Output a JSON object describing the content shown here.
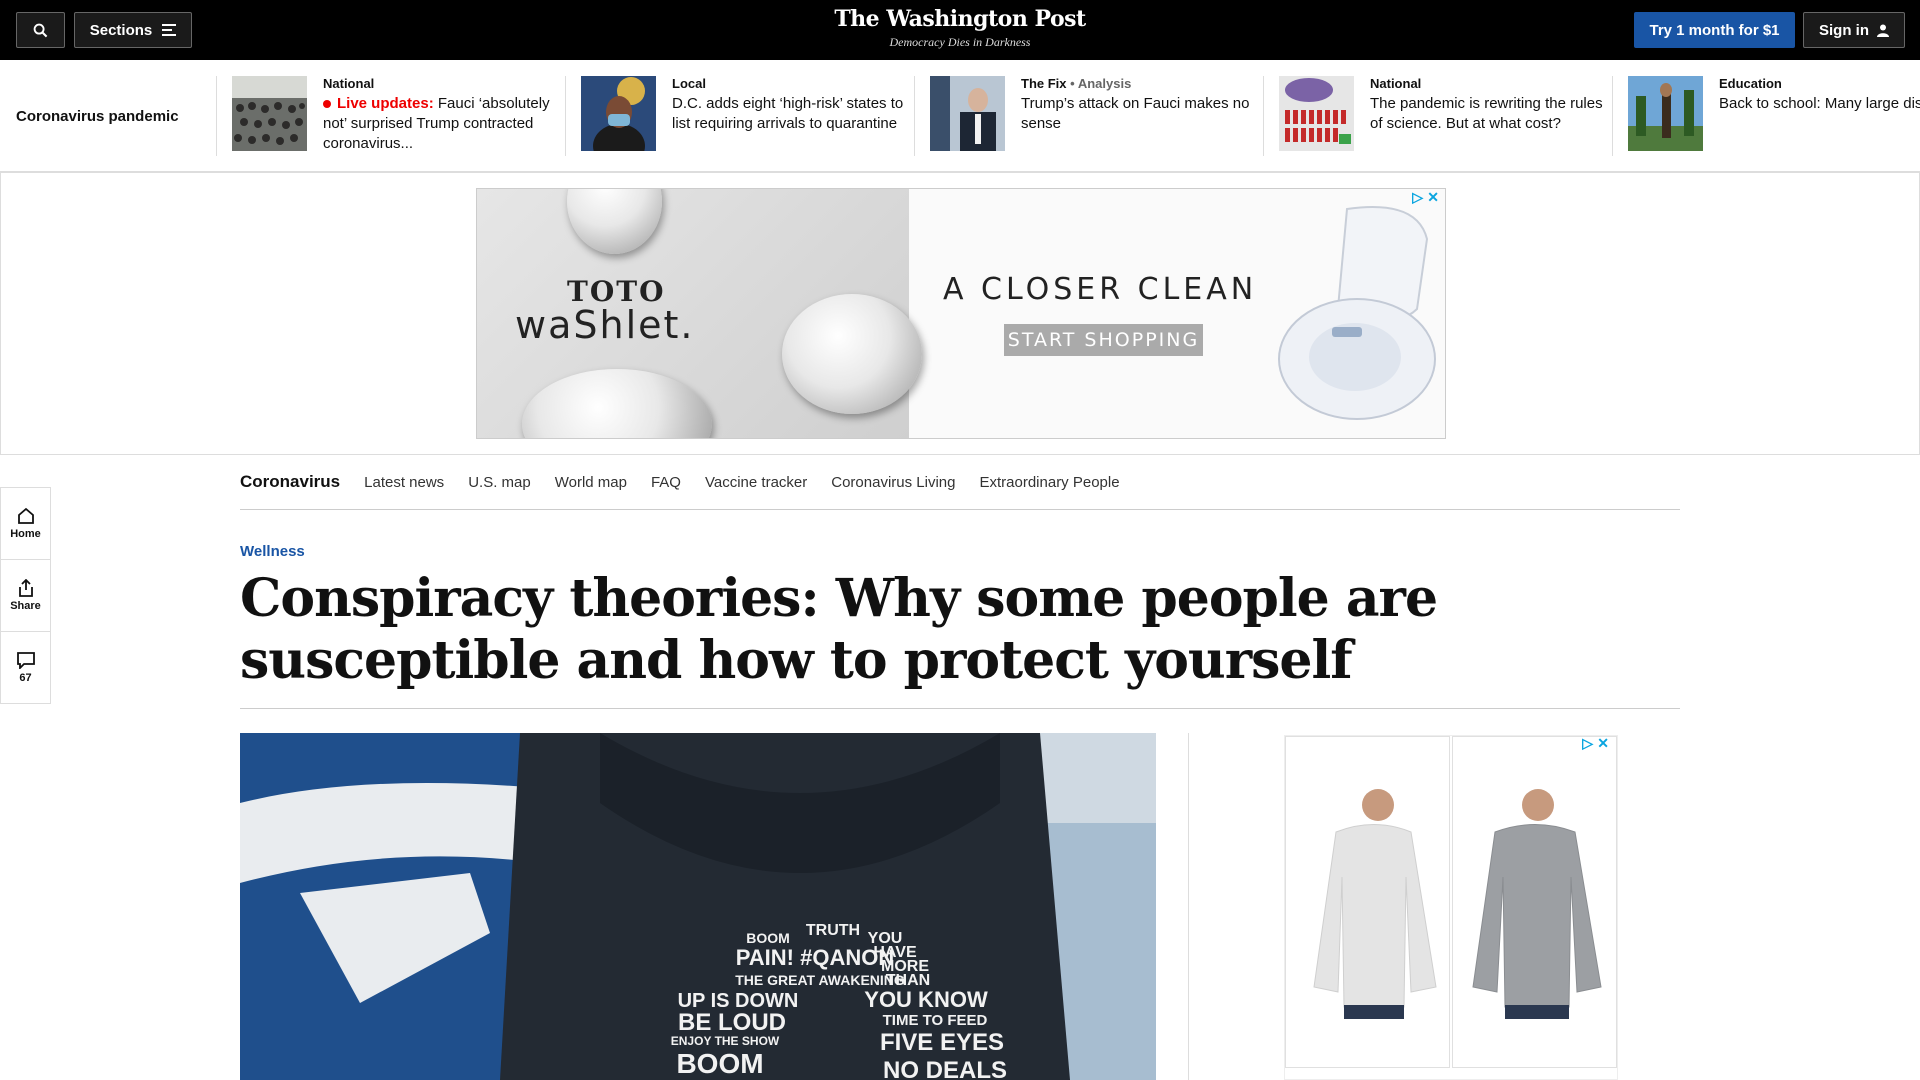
{
  "header": {
    "sections_label": "Sections",
    "logo": "The Washington Post",
    "tagline": "Democracy Dies in Darkness",
    "try_label": "Try 1 month for $1",
    "signin_label": "Sign in"
  },
  "strip": {
    "label": "Coronavirus pandemic",
    "items": [
      {
        "kicker": "National",
        "live": "Live updates:",
        "text": "Fauci ‘absolutely not’ surprised Trump contracted coronavirus..."
      },
      {
        "kicker": "Local",
        "text": "D.C. adds eight ‘high-risk’ states to list requiring arrivals to quarantine"
      },
      {
        "kicker": "The Fix",
        "analysis": "• Analysis",
        "text": "Trump’s attack on Fauci makes no sense"
      },
      {
        "kicker": "National",
        "text": "The pandemic is rewriting the rules of science. But at what cost?"
      },
      {
        "kicker": "Education",
        "text": "Back to school: Many large districts are opening doors ag"
      }
    ]
  },
  "ad": {
    "brand1": "TOTO",
    "brand2": "waShlet.",
    "headline": "A CLOSER CLEAN",
    "cta": "START SHOPPING"
  },
  "rail": {
    "home": "Home",
    "share": "Share",
    "comments": "67"
  },
  "subnav": [
    "Coronavirus",
    "Latest news",
    "U.S. map",
    "World map",
    "FAQ",
    "Vaccine tracker",
    "Coronavirus Living",
    "Extraordinary People"
  ],
  "article": {
    "section": "Wellness",
    "headline": "Conspiracy theories: Why some people are susceptible and how to protect yourself",
    "hoodie_lines": [
      "TRUTH",
      "BOOM",
      "YOU",
      "PAIN! #QANON",
      "HAVE",
      "MORE",
      "THE GREAT AWAKENING",
      "THAN",
      "UP IS DOWN",
      "YOU KNOW",
      "BE LOUD",
      "TIME TO FEED",
      "ENJOY THE SHOW",
      "FIVE EYES",
      "BOOM",
      "NO DEALS"
    ]
  },
  "colors": {
    "brand_blue": "#1955a5",
    "live_red": "#e00000",
    "adchoices": "#0aa5e0"
  }
}
